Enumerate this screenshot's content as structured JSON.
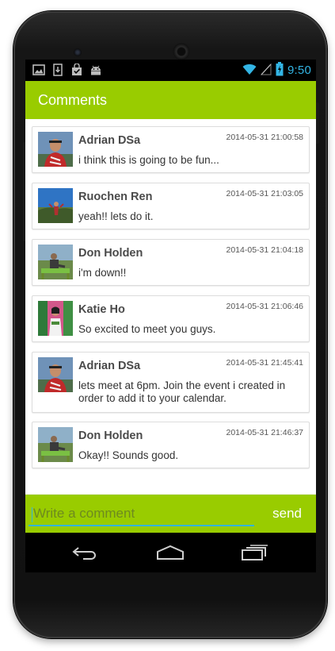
{
  "status_bar": {
    "time": "9:50",
    "left_icons": [
      "image-icon",
      "download-icon",
      "bag-check-icon",
      "android-icon"
    ],
    "right_icons": [
      "wifi-icon",
      "signal-icon",
      "battery-charging-icon"
    ]
  },
  "action_bar": {
    "title": "Comments"
  },
  "comments": [
    {
      "name": "Adrian DSa",
      "timestamp": "2014-05-31 21:00:58",
      "message": "i think this is going to be fun..."
    },
    {
      "name": "Ruochen Ren",
      "timestamp": "2014-05-31 21:03:05",
      "message": "yeah!! lets do it."
    },
    {
      "name": "Don Holden",
      "timestamp": "2014-05-31 21:04:18",
      "message": "i'm down!!"
    },
    {
      "name": "Katie Ho",
      "timestamp": "2014-05-31 21:06:46",
      "message": "So excited to meet you guys."
    },
    {
      "name": "Adrian DSa",
      "timestamp": "2014-05-31 21:45:41",
      "message": "lets meet at 6pm. Join the event i created in order to add it to your calendar."
    },
    {
      "name": "Don Holden",
      "timestamp": "2014-05-31 21:46:37",
      "message": "Okay!! Sounds good."
    }
  ],
  "composer": {
    "placeholder": "Write a comment",
    "value": "",
    "send_label": "send"
  },
  "colors": {
    "accent": "#99cc00",
    "holo_blue": "#33b5e5"
  },
  "nav_bar": {
    "buttons": [
      "back-icon",
      "home-icon",
      "recents-icon"
    ]
  }
}
